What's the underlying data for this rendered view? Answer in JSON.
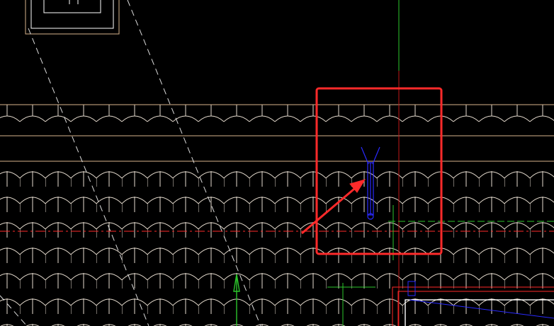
{
  "drawing": {
    "background": "#000000",
    "colors": {
      "tile": "#e6dccf",
      "band": "#d9b48c",
      "red_line": "#ff2a2a",
      "green_line": "#2cc62c",
      "blue_symbol": "#2a2aff",
      "highlight": "#ff2a2a",
      "dashed": "#dcdcdc",
      "frame": "#d9b48c"
    },
    "elements": [
      "roof-tile-band-upper",
      "roof-tile-field-lower",
      "eave-band",
      "dashed-diagonal-guides",
      "red-axis-lines",
      "green-axis-lines",
      "blue-fixture-symbol",
      "red-highlight-box",
      "red-callout-arrow",
      "green-up-arrow",
      "window-block-top-left",
      "building-corner-bottom-right"
    ]
  }
}
